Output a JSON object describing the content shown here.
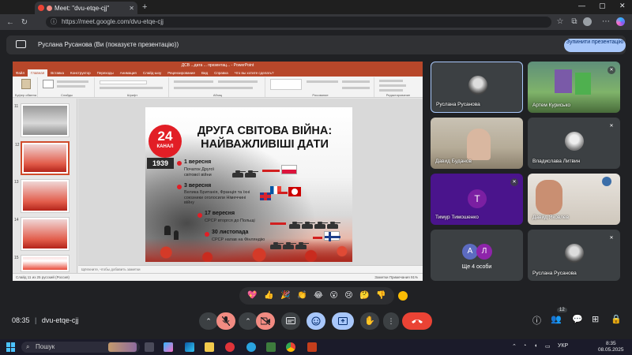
{
  "browser": {
    "tab_title": "Meet: \"dvu-etqe-cjj\"",
    "tab_close": "✕",
    "new_tab": "+",
    "url": "https://meet.google.com/dvu-etqe-cjj",
    "win_minimize": "—",
    "win_maximize": "▢",
    "win_close": "✕"
  },
  "banner": {
    "text": "Руслана Русанова (Ви (показуєте презентацію))",
    "stop_button": "Зупинити презентацію"
  },
  "powerpoint": {
    "window_title": "ДСВ ...дата ... презентац... - PowerPoint",
    "tabs": [
      "Файл",
      "Главная",
      "Вставка",
      "Конструктор",
      "Переходы",
      "Анимация",
      "Слайд-шоу",
      "Рецензирование",
      "Вид",
      "Справка",
      "Что вы хотите сделать?"
    ],
    "ribbon_groups": [
      "Буфер обмена",
      "Слайды",
      "Шрифт",
      "Абзац",
      "Рисование",
      "Редактирование"
    ],
    "thumb_numbers": [
      "11",
      "12",
      "13",
      "14",
      "15"
    ],
    "notes_placeholder": "Щёлкните, чтобы добавить заметки",
    "status_text": "Слайд 11 из 25   русский (Россия)",
    "status_right": "Заметки   Примечания   91%"
  },
  "slide": {
    "logo_number": "24",
    "logo_text": "КАНАЛ",
    "title_line1": "ДРУГА СВІТОВА ВІЙНА:",
    "title_line2": "НАЙВАЖЛИВІШІ ДАТИ",
    "year": "1939",
    "events": [
      {
        "date": "1 вересня",
        "text": "Початок Другої світової війни"
      },
      {
        "date": "3 вересня",
        "text": "Велика Британія, Франція та їхні союзники оголосили Німеччині війну"
      },
      {
        "date": "17 вересня",
        "text": "СРСР вторгся до Польщі"
      },
      {
        "date": "30 листопада",
        "text": "СРСР напав на Фінляндію"
      }
    ]
  },
  "participants": [
    {
      "name": "Руслана Русанова",
      "muted": false
    },
    {
      "name": "Артем Курисько",
      "muted": true
    },
    {
      "name": "Давид Буданов",
      "muted": false
    },
    {
      "name": "Владислава Литвин",
      "muted": true
    },
    {
      "name": "Тимур Тимошенко",
      "muted": true,
      "initial": "Т",
      "color": "#7b1fa2"
    },
    {
      "name": "Давид Яковлев",
      "muted": false
    },
    {
      "name": "Ще 4 особи",
      "initials": [
        "А",
        "Л"
      ],
      "colors": [
        "#5c6bc0",
        "#8e24aa"
      ]
    },
    {
      "name": "Руслана Русанова",
      "muted": true
    }
  ],
  "reactions": [
    "💖",
    "👍",
    "🎉",
    "👏",
    "😂",
    "😮",
    "😢",
    "🤔",
    "👎"
  ],
  "controls": {
    "time": "08:35",
    "meeting_code": "dvu-etqe-cjj",
    "participants_count": "12",
    "caret": "⌃",
    "more": "⋮"
  },
  "taskbar": {
    "search_placeholder": "Пошук",
    "language": "УКР",
    "time": "8:35",
    "date": "08.05.2025"
  },
  "colors": {
    "meet_bg": "#202124",
    "tile_bg": "#3c4043",
    "accent_blue": "#a8c7fa",
    "end_call_red": "#ea4335",
    "ppt_red": "#b7472a"
  }
}
